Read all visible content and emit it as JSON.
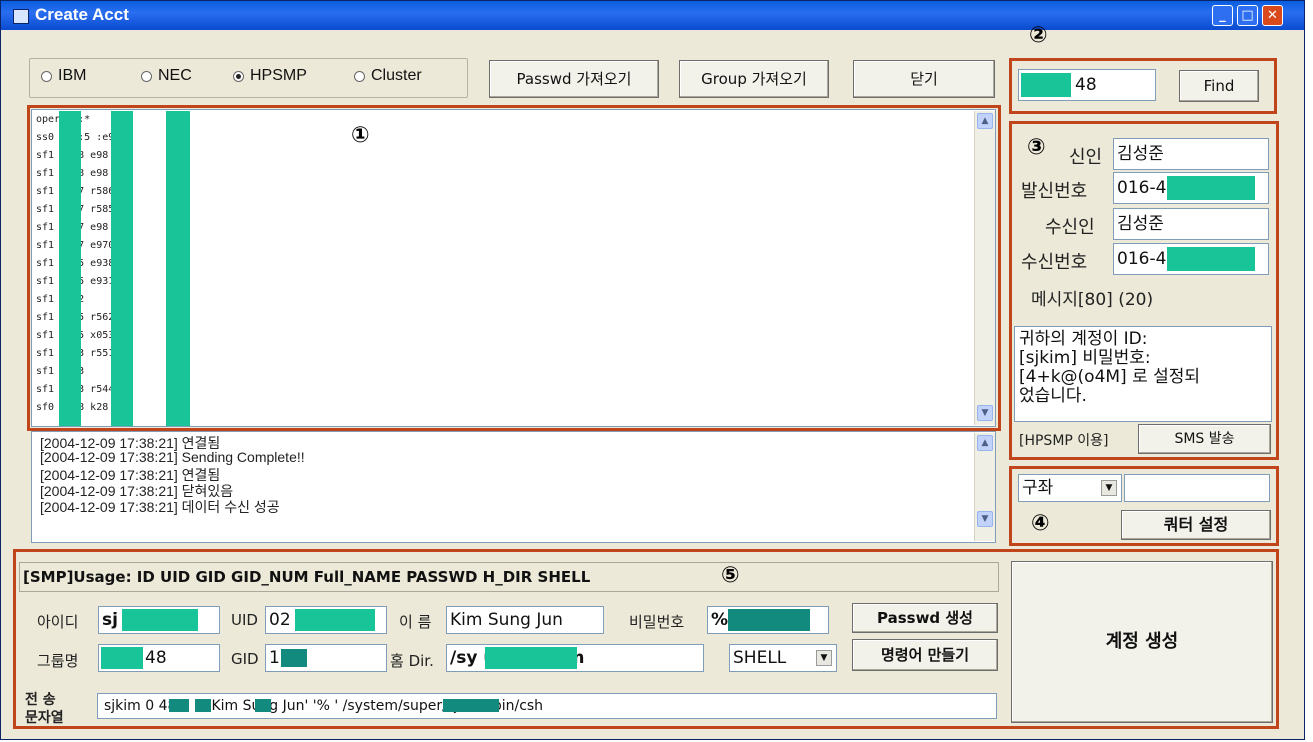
{
  "window": {
    "title": "Create Acct"
  },
  "markers": {
    "m1": "①",
    "m2": "②",
    "m3": "③",
    "m4": "④",
    "m5": "⑤"
  },
  "radios": [
    {
      "label": "IBM",
      "checked": false
    },
    {
      "label": "NEC",
      "checked": false
    },
    {
      "label": "HPSMP",
      "checked": true
    },
    {
      "label": "Cluster",
      "checked": false
    }
  ],
  "toolbar": {
    "passwd_btn": "Passwd 가져오기",
    "group_btn": "Group 가져오기",
    "close_btn": "닫기"
  },
  "account_list": [
    "oper     or:*",
    "ss0   5:*:5      :e95",
    "sf1     *:28      e98",
    "sf1     *:28      e98",
    "sf1     *:27      r586",
    "sf1     *:27      r585",
    "sf1     *:27      e98      y",
    "sf1     *:27      e970",
    "sf1     *:25      e938",
    "sf1     *:25      e931",
    "sf1     *:52",
    "sf1     *:25      r562      s",
    "sf1     *:25      x053",
    "sf1     *:23      r551",
    "sf1     *:23",
    "sf1     *:23      r544",
    "sf0     *:18      k28"
  ],
  "log_lines": [
    "[2004-12-09 17:38:21] 연결됨",
    "[2004-12-09 17:38:21] Sending Complete!!",
    "[2004-12-09 17:38:21] 연결됨",
    "[2004-12-09 17:38:21] 닫혀있음",
    "[2004-12-09 17:38:21] 데이터 수신 성공"
  ],
  "find": {
    "value": "48",
    "button": "Find"
  },
  "sms": {
    "sender_label": "신인",
    "sender_value": "김성준",
    "sender_phone_label": "발신번호",
    "sender_phone_value": "016-4",
    "receiver_label": "수신인",
    "receiver_value": "김성준",
    "receiver_phone_label": "수신번호",
    "receiver_phone_value": "016-4",
    "message_label": "메시지[80] (20)",
    "message_text": "귀하의 계정이 ID:\n[sjkim] 비밀번호:\n[4+k@(o4M] 로 설정되\n었습니다.",
    "hpsmp_label": "[HPSMP 이용]",
    "send_button": "SMS 발송"
  },
  "quota": {
    "select_value": "구좌",
    "input_value": "",
    "button": "쿼터 설정"
  },
  "form": {
    "usage": "[SMP]Usage: ID UID GID GID_NUM Full_NAME PASSWD H_DIR SHELL",
    "id_label": "아이디",
    "id_value": "sj",
    "uid_label": "UID",
    "uid_value": "02",
    "name_label": "이 름",
    "name_value": "Kim Sung Jun",
    "pw_label": "비밀번호",
    "pw_value": "%",
    "passwd_gen_btn": "Passwd 생성",
    "group_label": "그룹명",
    "group_value": "48",
    "gid_label": "GID",
    "gid_value": "1    8",
    "home_label": "홈 Dir.",
    "home_value": "/sy                uper/sjkim",
    "shell_value": "SHELL",
    "make_cmd_btn": "명령어 만들기",
    "send_str_label_1": "전  송",
    "send_str_label_2": "문자열",
    "send_str_value": "sjkim 0       48 1    8 'Kim Sung Jun' '%          ' /system/super/sjkim /bin/csh",
    "create_btn": "계정 생성"
  }
}
